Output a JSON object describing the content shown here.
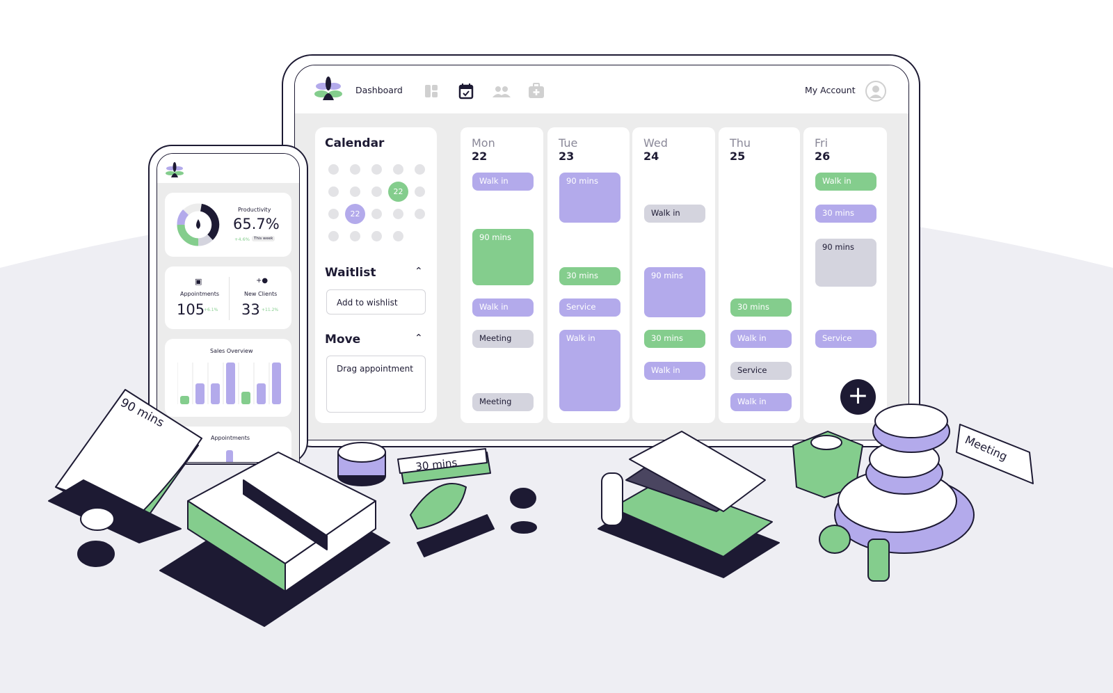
{
  "colors": {
    "purple": "#b3aaeb",
    "green": "#84cd8d",
    "gray": "#d4d4de",
    "dark": "#1d1a33",
    "background": "#eeeef3"
  },
  "header": {
    "title": "Dashboard",
    "account": "My Account",
    "nav_icons": [
      "layout-icon",
      "calendar-check-icon",
      "users-icon",
      "medical-kit-icon"
    ],
    "active": "calendar-check-icon"
  },
  "sidebar": {
    "calendar_title": "Calendar",
    "selected_days": [
      "22",
      "22"
    ],
    "waitlist_title": "Waitlist",
    "waitlist_button": "Add to wishlist",
    "move_title": "Move",
    "move_placeholder": "Drag appointment"
  },
  "days": [
    {
      "name": "Mon",
      "num": "22",
      "events": [
        {
          "label": "Walk in",
          "color": "purple"
        },
        {
          "label": "90 mins",
          "color": "green"
        },
        {
          "label": "Walk in",
          "color": "purple"
        },
        {
          "label": "Meeting",
          "color": "gray"
        },
        {
          "label": "Meeting",
          "color": "gray"
        }
      ]
    },
    {
      "name": "Tue",
      "num": "23",
      "events": [
        {
          "label": "90 mins",
          "color": "purple"
        },
        {
          "label": "30 mins",
          "color": "green"
        },
        {
          "label": "Service",
          "color": "purple"
        },
        {
          "label": "Walk in",
          "color": "purple"
        }
      ]
    },
    {
      "name": "Wed",
      "num": "24",
      "events": [
        {
          "label": "Walk in",
          "color": "gray"
        },
        {
          "label": "90 mins",
          "color": "purple"
        },
        {
          "label": "30 mins",
          "color": "green"
        },
        {
          "label": "Walk in",
          "color": "purple"
        }
      ]
    },
    {
      "name": "Thu",
      "num": "25",
      "events": [
        {
          "label": "30 mins",
          "color": "green"
        },
        {
          "label": "Walk in",
          "color": "purple"
        },
        {
          "label": "Service",
          "color": "gray"
        },
        {
          "label": "Walk in",
          "color": "purple"
        }
      ]
    },
    {
      "name": "Fri",
      "num": "26",
      "events": [
        {
          "label": "Walk in",
          "color": "green"
        },
        {
          "label": "30 mins",
          "color": "purple"
        },
        {
          "label": "90 mins",
          "color": "gray"
        },
        {
          "label": "Service",
          "color": "purple"
        }
      ]
    }
  ],
  "phone": {
    "productivity_label": "Productivity",
    "productivity_value": "65.7%",
    "productivity_change": "+4.6%",
    "productivity_period": "This week",
    "appointments_label": "Appointments",
    "appointments_value": "105",
    "appointments_change": "+6.1%",
    "clients_label": "New Clients",
    "clients_value": "33",
    "clients_change": "+11.2%",
    "sales_title": "Sales Overview",
    "sales_bars": [
      {
        "value": 2,
        "color": "green"
      },
      {
        "value": 5,
        "color": "purple"
      },
      {
        "value": 5,
        "color": "purple"
      },
      {
        "value": 10,
        "color": "purple"
      },
      {
        "value": 3,
        "color": "green"
      },
      {
        "value": 5,
        "color": "purple"
      },
      {
        "value": 10,
        "color": "purple"
      }
    ],
    "appointments_card_title": "Appointments"
  },
  "props": {
    "book_label": "90 mins",
    "tag_label": "30 mins",
    "meeting_label": "Meeting"
  }
}
